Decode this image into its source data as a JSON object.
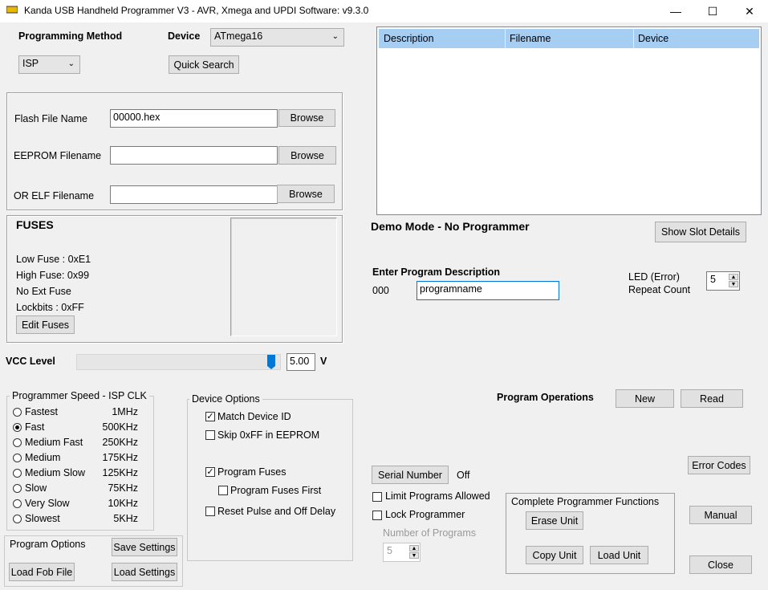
{
  "window": {
    "title": "Kanda USB Handheld Programmer V3 - AVR, Xmega and UPDI  Software: v9.3.0",
    "minimize": "—",
    "maximize": "☐",
    "close": "✕"
  },
  "method": {
    "label": "Programming Method",
    "value": "ISP"
  },
  "device": {
    "label": "Device",
    "value": "ATmega16",
    "quick_search": "Quick Search"
  },
  "files": {
    "flash_label": "Flash File Name",
    "flash_value": "00000.hex",
    "eeprom_label": "EEPROM Filename",
    "eeprom_value": "",
    "elf_label": "OR ELF Filename",
    "elf_value": "",
    "browse": "Browse"
  },
  "fuses": {
    "title": "FUSES",
    "low": "Low Fuse :  0xE1",
    "high": "High Fuse:  0x99",
    "ext": "No Ext Fuse",
    "lock": "Lockbits :  0xFF",
    "edit": "Edit Fuses"
  },
  "vcc": {
    "label": "VCC Level",
    "value": "5.00",
    "unit": "V",
    "level_fraction": 1.0
  },
  "speed": {
    "title": "Programmer Speed - ISP CLK",
    "items": [
      {
        "name": "Fastest",
        "freq": "1MHz",
        "selected": false
      },
      {
        "name": "Fast",
        "freq": "500KHz",
        "selected": true
      },
      {
        "name": "Medium Fast",
        "freq": "250KHz",
        "selected": false
      },
      {
        "name": "Medium",
        "freq": "175KHz",
        "selected": false
      },
      {
        "name": "Medium Slow",
        "freq": "125KHz",
        "selected": false
      },
      {
        "name": "Slow",
        "freq": "75KHz",
        "selected": false
      },
      {
        "name": "Very Slow",
        "freq": "10KHz",
        "selected": false
      },
      {
        "name": "Slowest",
        "freq": "5KHz",
        "selected": false
      }
    ]
  },
  "device_options": {
    "title": "Device Options",
    "match_id": "Match Device ID",
    "skip_ff": "Skip 0xFF in EEPROM",
    "prog_fuses": "Program Fuses",
    "prog_fuses_first": "Program Fuses First",
    "reset_pulse": "Reset Pulse and Off Delay"
  },
  "program_options": {
    "title": "Program Options",
    "save": "Save Settings",
    "load_fob": "Load Fob File",
    "load": "Load Settings"
  },
  "slots": {
    "columns": [
      "Description",
      "Filename",
      "Device"
    ]
  },
  "status": {
    "mode": "Demo Mode - No Programmer",
    "show_slot": "Show Slot Details"
  },
  "description": {
    "title": "Enter Program Description",
    "number": "000",
    "value": "programname"
  },
  "led": {
    "line1": "LED (Error)",
    "line2": "Repeat Count",
    "value": "5"
  },
  "operations": {
    "title": "Program Operations",
    "new": "New",
    "read": "Read",
    "error_codes": "Error Codes"
  },
  "serial": {
    "button": "Serial Number",
    "state": "Off",
    "limit": "Limit Programs Allowed",
    "lock": "Lock Programmer",
    "num_label": "Number of Programs",
    "num_value": "5"
  },
  "complete": {
    "title": "Complete Programmer Functions",
    "erase": "Erase Unit",
    "copy": "Copy Unit",
    "load": "Load Unit"
  },
  "footer": {
    "manual": "Manual",
    "close": "Close"
  }
}
